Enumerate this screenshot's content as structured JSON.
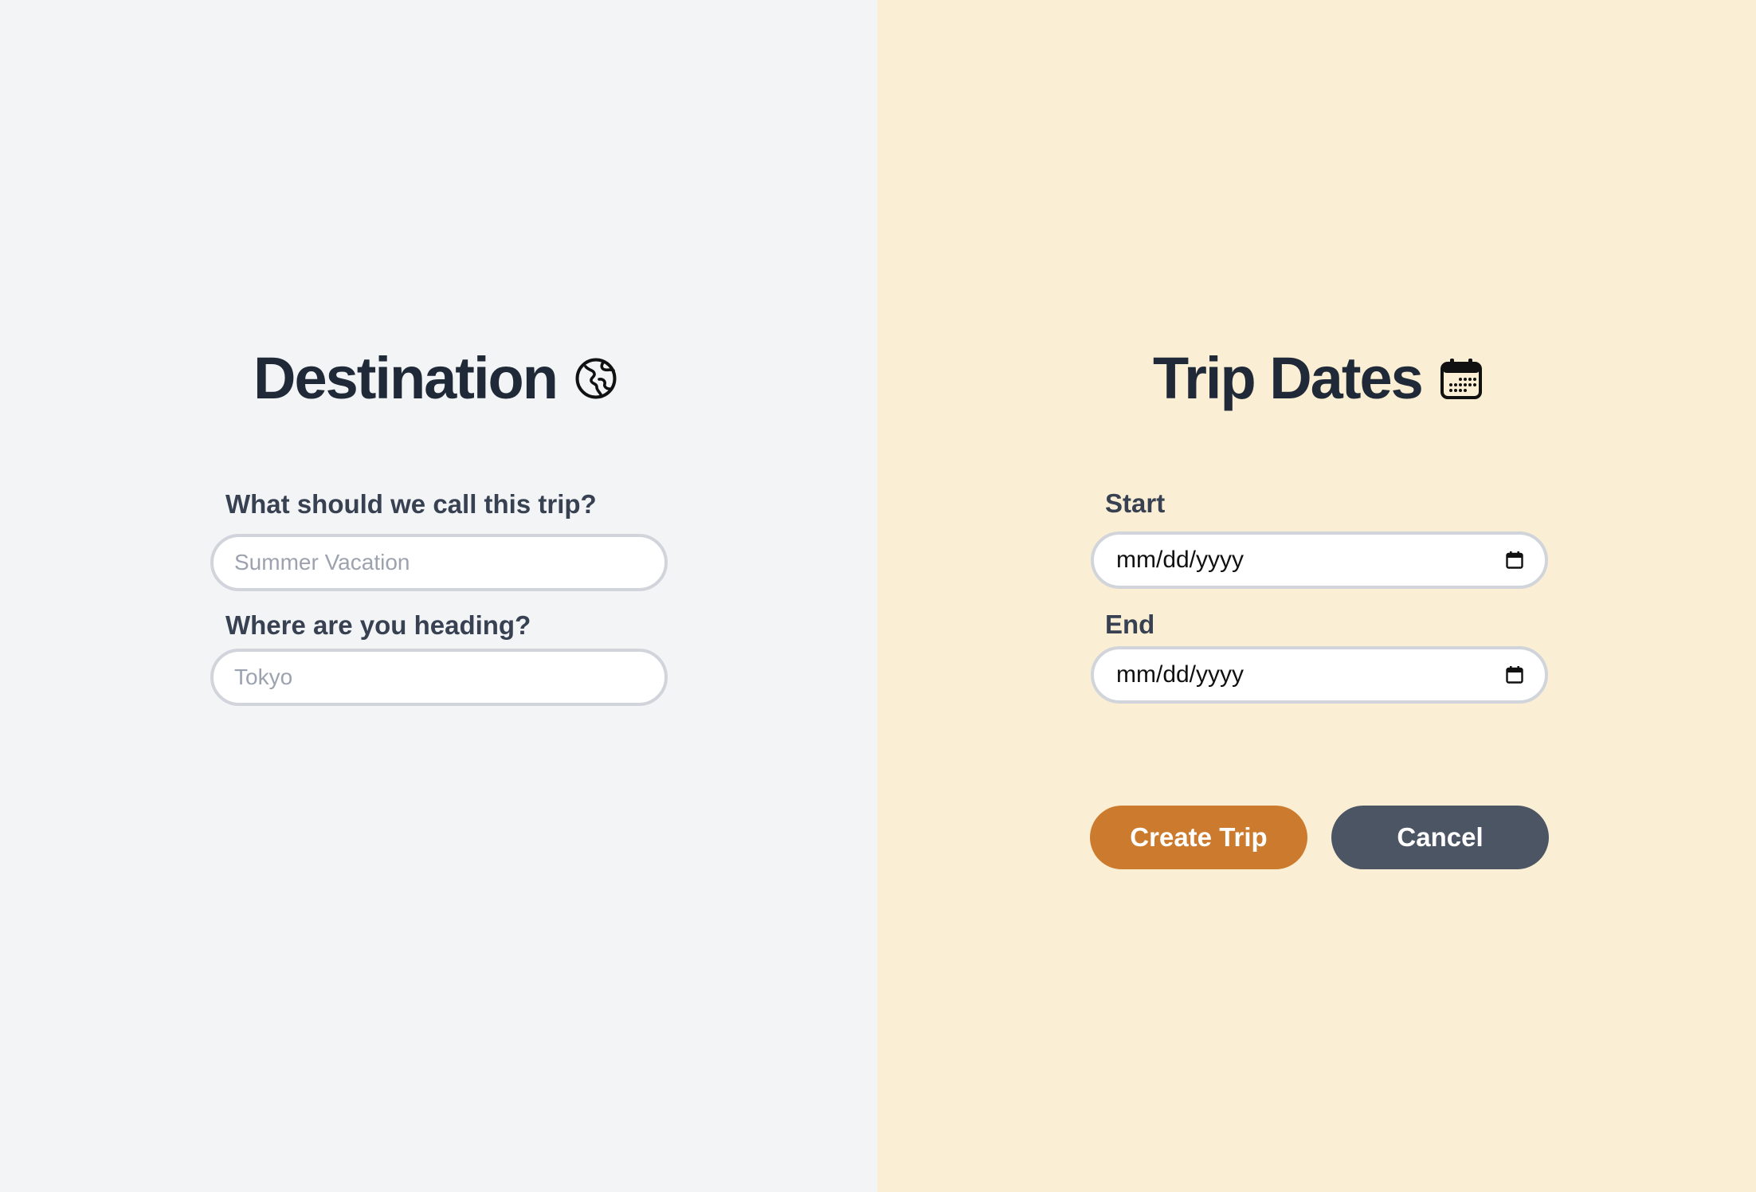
{
  "destination": {
    "heading": "Destination",
    "heading_icon": "globe-icon",
    "trip_name_label": "What should we call this trip?",
    "trip_name_placeholder": "Summer Vacation",
    "trip_name_value": "",
    "heading_to_label": "Where are you heading?",
    "heading_to_placeholder": "Tokyo",
    "heading_to_value": ""
  },
  "dates": {
    "heading": "Trip Dates",
    "heading_icon": "calendar-icon",
    "start_label": "Start",
    "start_value": "mm/dd/yyyy",
    "end_label": "End",
    "end_value": "mm/dd/yyyy",
    "date_picker_icon": "calendar-icon"
  },
  "actions": {
    "create_label": "Create Trip",
    "cancel_label": "Cancel"
  },
  "colors": {
    "left_background": "#f3f4f6",
    "right_background": "#faefd4",
    "heading_text": "#1f2937",
    "label_text": "#374151",
    "primary_button": "#cc7b2e",
    "secondary_button": "#4b5563",
    "input_border": "#d1d5db",
    "placeholder_text": "#9ca3af"
  }
}
